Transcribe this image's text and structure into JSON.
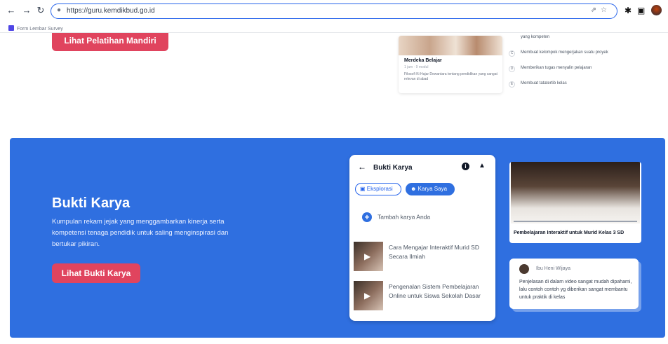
{
  "browser": {
    "back_icon": "arrow-left-icon",
    "forward_icon": "arrow-right-icon",
    "reload_icon": "reload-icon",
    "url": "https://guru.kemdikbud.go.id",
    "bookmark_label": "Form Lembar Survey"
  },
  "top": {
    "pelatihan_button": "Lihat Pelatihan Mandiri",
    "merdeka_card": {
      "title": "Merdeka Belajar",
      "meta": "1 jam · 9 modul",
      "description": "Filosofi Ki Hajar Dewantara tentang pendidikan yang sangat relevan di abad"
    },
    "steps": [
      {
        "num": "",
        "text": "yang kompeten"
      },
      {
        "num": "C",
        "text": "Membuat kelompok mengerjakan suatu proyek"
      },
      {
        "num": "D",
        "text": "Memberikan tugas menyalin pelajaran"
      },
      {
        "num": "E",
        "text": "Membuat tatatertib kelas"
      }
    ]
  },
  "bukti": {
    "title": "Bukti Karya",
    "description": "Kumpulan rekam jejak yang menggambarkan kinerja serta kompetensi tenaga pendidik untuk saling menginspirasi dan bertukar pikiran.",
    "button": "Lihat Bukti Karya",
    "colors": {
      "section_bg": "#2f6fe0",
      "button_bg": "#e0445e"
    }
  },
  "app": {
    "title": "Bukti Karya",
    "tabs": [
      {
        "label": "Eksplorasi",
        "icon": "image-icon"
      },
      {
        "label": "Karya Saya",
        "icon": "users-icon"
      }
    ],
    "add_label": "Tambah karya Anda",
    "videos": [
      {
        "title": "Cara Mengajar Interaktif Murid SD Secara Ilmiah"
      },
      {
        "title": "Pengenalan Sistem Pembelajaran Online untuk Siswa Sekolah Dasar"
      }
    ]
  },
  "video_card": {
    "caption": "Pembelajaran Interaktif untuk Murid Kelas 3 SD"
  },
  "comment": {
    "name": "Ibu Heni Wijaya",
    "text": "Penjelasan di dalam video sangat mudah dipahami, lalu contoh contoh yg diberikan sangat membantu untuk praktik di kelas"
  }
}
